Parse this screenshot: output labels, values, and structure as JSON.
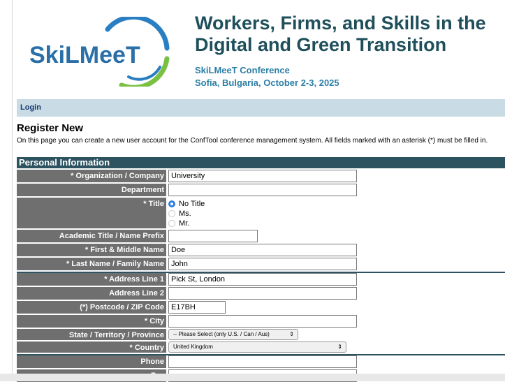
{
  "header": {
    "logo_text": "SkiLMeeT",
    "headline_line1": "Workers, Firms, and Skills in the",
    "headline_line2": "Digital and Green Transition",
    "conference_name": "SkiLMeeT Conference",
    "conference_place": "Sofia, Bulgaria, October 2-3, 2025",
    "colors": {
      "headline": "#1e4f5b",
      "subtitle": "#2b7fa6",
      "logo_green": "#7ac143",
      "logo_blue": "#2a7ec2"
    }
  },
  "nav": {
    "login_label": "Login",
    "bar_color": "#c9dce6"
  },
  "page": {
    "heading": "Register New",
    "intro": "On this page you can create a new user account for the ConfTool conference management system. All fields marked with an asterisk (*) must be filled in."
  },
  "form": {
    "section_title": "Personal Information",
    "header_color": "#2d5360",
    "label_color": "#6f6f6f",
    "organization": {
      "label": "* Organization / Company",
      "value": "University"
    },
    "department": {
      "label": "Department",
      "value": ""
    },
    "title": {
      "label": "* Title",
      "options": [
        "No Title",
        "Ms.",
        "Mr."
      ],
      "selected": "No Title"
    },
    "academic_title": {
      "label": "Academic Title / Name Prefix",
      "value": ""
    },
    "first_name": {
      "label": "* First & Middle Name",
      "value": "Doe"
    },
    "last_name": {
      "label": "* Last Name / Family Name",
      "value": "John"
    },
    "address1": {
      "label": "* Address Line 1",
      "value": "Pick St, London"
    },
    "address2": {
      "label": "Address Line 2",
      "value": ""
    },
    "postcode": {
      "label": "(*) Postcode / ZIP Code",
      "value": "E17BH"
    },
    "city": {
      "label": "* City",
      "value": ""
    },
    "state": {
      "label": "State / Territory / Province",
      "value": "-- Please Select (only U.S. / Can / Aus)"
    },
    "country": {
      "label": "* Country",
      "value": "United Kingdom"
    },
    "phone": {
      "label": "Phone",
      "value": ""
    },
    "fax": {
      "label": "Fax",
      "value": ""
    }
  }
}
